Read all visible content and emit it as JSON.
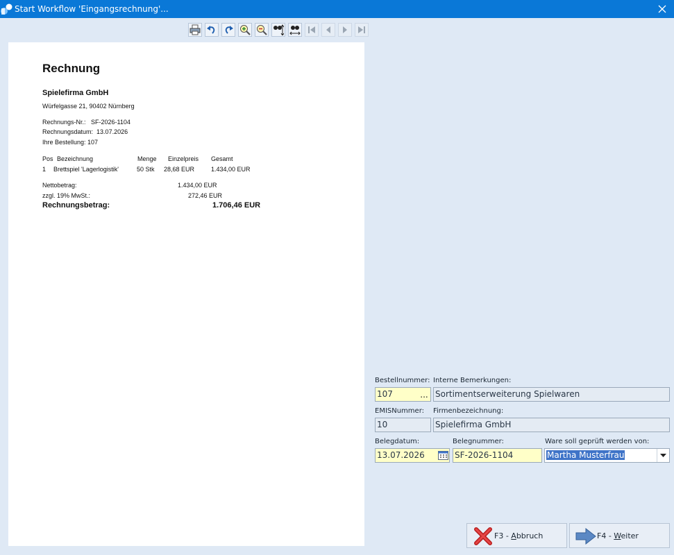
{
  "window": {
    "title": "Start Workflow 'Eingangsrechnung'..."
  },
  "document": {
    "heading": "Rechnung",
    "company": "Spielefirma GmbH",
    "address": "Würfelgasse 21, 90402 Nürnberg",
    "invoice_no": "Rechnungs-Nr.:   SF-2026-1104",
    "invoice_date": "Rechnungsdatum:  13.07.2026",
    "order": "Ihre Bestellung: 107",
    "table": {
      "headers": {
        "pos": "Pos",
        "description": "Bezeichnung",
        "qty": "Menge",
        "unit_price": "Einzelpreis",
        "total": "Gesamt"
      },
      "rows": [
        {
          "pos": "1",
          "description": "Brettspiel 'Lagerlogistik'",
          "qty": "50 Stk",
          "unit_price": "28,68 EUR",
          "total": "1.434,00 EUR"
        }
      ]
    },
    "net_label": "Nettobetrag:",
    "net_value": "1.434,00 EUR",
    "vat_label": "zzgl. 19% MwSt.:",
    "vat_value": "272,46 EUR",
    "gross_label": "Rechnungsbetrag:",
    "gross_value": "1.706,46 EUR"
  },
  "form": {
    "order_number": {
      "label": "Bestellnummer:",
      "value": "107",
      "button": "..."
    },
    "internal_notes": {
      "label": "Interne Bemerkungen:",
      "value": "Sortimentserweiterung Spielwaren"
    },
    "emis_number": {
      "label": "EMISNummer:",
      "value": "10"
    },
    "company_name": {
      "label": "Firmenbezeichnung:",
      "value": "Spielefirma GmbH"
    },
    "doc_date": {
      "label": "Belegdatum:",
      "value": "13.07.2026"
    },
    "doc_number": {
      "label": "Belegnummer:",
      "value": "SF-2026-1104"
    },
    "reviewer": {
      "label": "Ware soll geprüft werden von:",
      "value": "Martha Musterfrau"
    }
  },
  "buttons": {
    "cancel": {
      "key": "F3 - ",
      "accel": "A",
      "rest": "bbruch"
    },
    "next": {
      "key": "F4 - ",
      "accel": "W",
      "rest": "eiter"
    }
  },
  "colors": {
    "titlebar": "#0a78d7",
    "background": "#dfe9f5",
    "required_field": "#ffffc8",
    "selection": "#3f74c8"
  },
  "icons": [
    "app-icon",
    "close-icon",
    "print-icon",
    "undo-icon",
    "redo-icon",
    "zoom-in-icon",
    "zoom-out-icon",
    "fit-height-icon",
    "fit-width-icon",
    "first-page-icon",
    "prev-page-icon",
    "next-page-icon",
    "last-page-icon",
    "calendar-icon",
    "dropdown-arrow-icon",
    "cancel-x-icon",
    "next-arrow-icon"
  ]
}
